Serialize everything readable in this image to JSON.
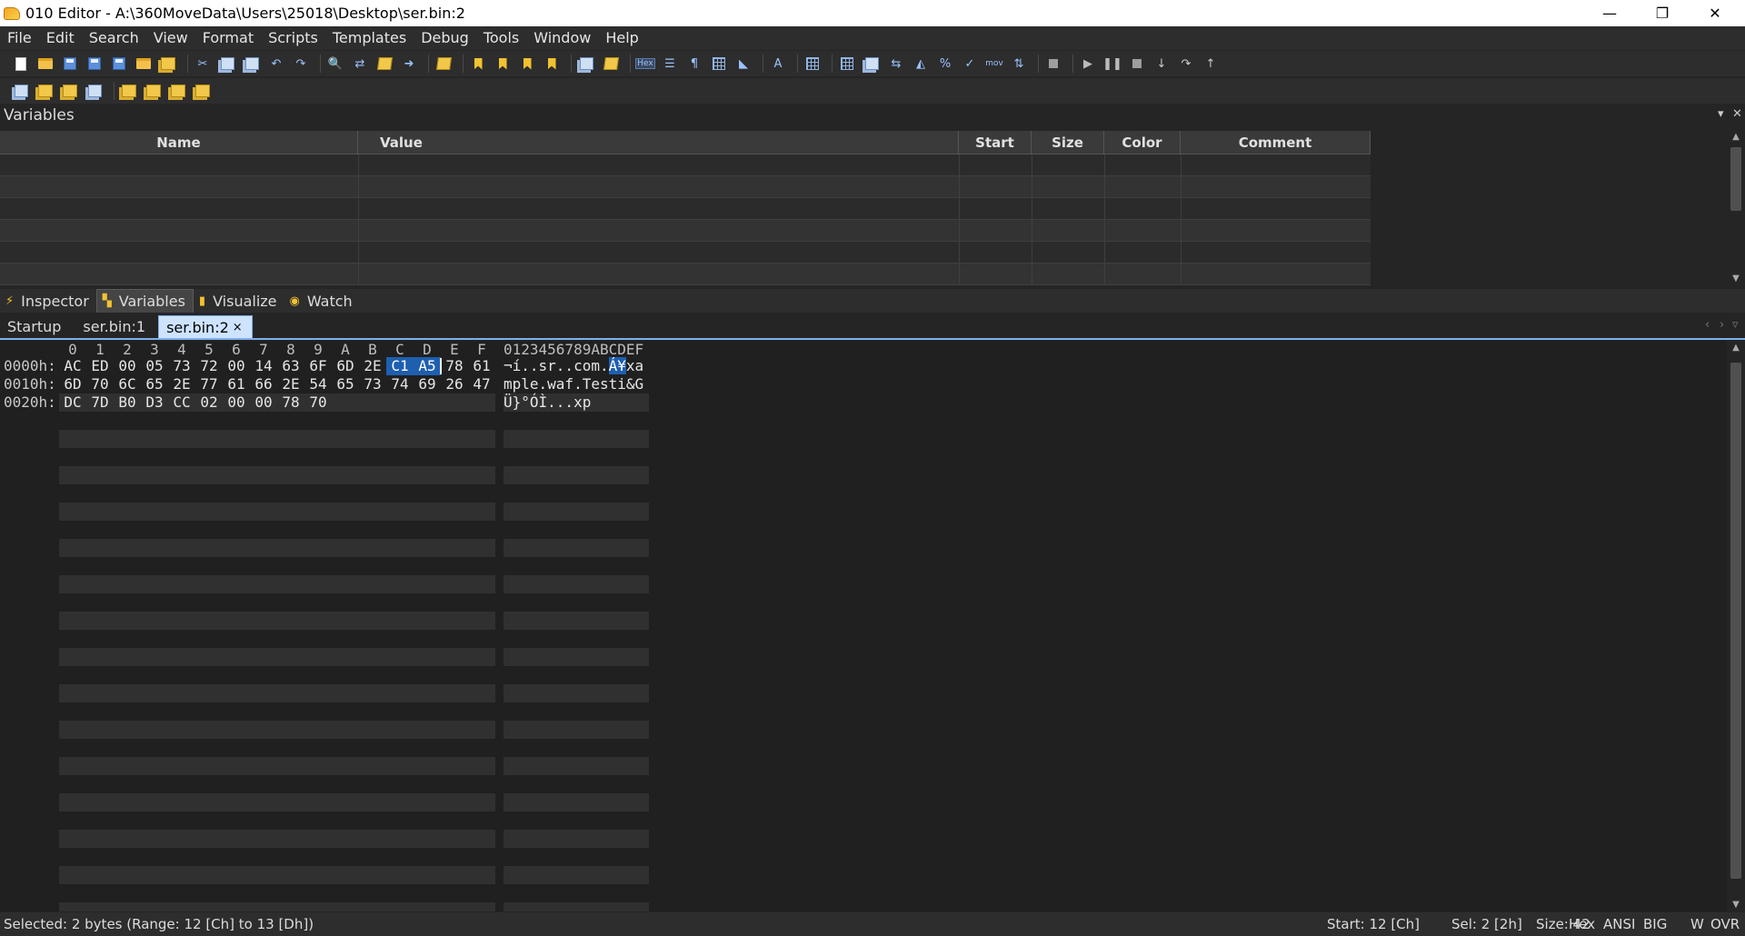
{
  "window": {
    "title": "010 Editor - A:\\360MoveData\\Users\\25018\\Desktop\\ser.bin:2",
    "minimize": "—",
    "maximize": "❐",
    "close": "✕"
  },
  "menu": [
    "File",
    "Edit",
    "Search",
    "View",
    "Format",
    "Scripts",
    "Templates",
    "Debug",
    "Tools",
    "Window",
    "Help"
  ],
  "variables_panel": {
    "title": "Variables",
    "columns": [
      "Name",
      "Value",
      "Start",
      "Size",
      "Color",
      "Comment"
    ],
    "pin_icon": "▾",
    "close_icon": "✕"
  },
  "panel_tabs": [
    {
      "label": "Inspector",
      "icon": "lightning-icon"
    },
    {
      "label": "Variables",
      "icon": "variables-icon"
    },
    {
      "label": "Visualize",
      "icon": "visualize-icon"
    },
    {
      "label": "Watch",
      "icon": "eye-icon"
    }
  ],
  "file_tabs": [
    {
      "label": "Startup"
    },
    {
      "label": "ser.bin:1"
    },
    {
      "label": "ser.bin:2",
      "close": "×"
    }
  ],
  "hex": {
    "column_headers": [
      "0",
      "1",
      "2",
      "3",
      "4",
      "5",
      "6",
      "7",
      "8",
      "9",
      "A",
      "B",
      "C",
      "D",
      "E",
      "F"
    ],
    "ascii_header": "0123456789ABCDEF",
    "rows": [
      {
        "addr": "0000h:",
        "bytes": [
          "AC",
          "ED",
          "00",
          "05",
          "73",
          "72",
          "00",
          "14",
          "63",
          "6F",
          "6D",
          "2E",
          "C1",
          "A5",
          "78",
          "61"
        ],
        "ascii_pre": "¬í..sr..com.",
        "ascii_sel": "Á¥",
        "ascii_post": "xa"
      },
      {
        "addr": "0010h:",
        "bytes": [
          "6D",
          "70",
          "6C",
          "65",
          "2E",
          "77",
          "61",
          "66",
          "2E",
          "54",
          "65",
          "73",
          "74",
          "69",
          "26",
          "47"
        ],
        "ascii_pre": "mple.waf.Testi&G",
        "ascii_sel": "",
        "ascii_post": ""
      },
      {
        "addr": "0020h:",
        "bytes": [
          "DC",
          "7D",
          "B0",
          "D3",
          "CC",
          "02",
          "00",
          "00",
          "78",
          "70"
        ],
        "ascii_pre": "Ü}°ÓÌ...xp",
        "ascii_sel": "",
        "ascii_post": ""
      }
    ],
    "selected_start": 12,
    "selected_end": 13
  },
  "status": {
    "selection": "Selected: 2 bytes (Range: 12 [Ch] to 13 [Dh])",
    "start": "Start: 12 [Ch]",
    "sel": "Sel: 2 [2h]",
    "size": "Size: 42",
    "mode_hex": "Hex",
    "encoding": "ANSI",
    "endian": "BIG",
    "w": "W",
    "ovr": "OVR"
  },
  "colors": {
    "selection": "#1e5fb0",
    "background": "#202020",
    "panel": "#2d2d2d"
  }
}
